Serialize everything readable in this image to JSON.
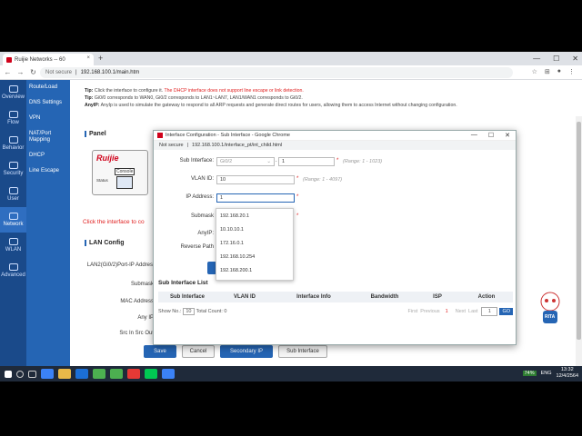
{
  "browser": {
    "tab_title": "Ruijie Networks -- 60",
    "tab_close": "×",
    "new_tab": "+",
    "security": "Not secure",
    "url": "192.168.100.1/main.htm",
    "win_min": "—",
    "win_max": "☐",
    "win_close": "✕"
  },
  "sidebar": {
    "items": [
      {
        "label": "Overview"
      },
      {
        "label": "Flow"
      },
      {
        "label": "Behavior"
      },
      {
        "label": "Security"
      },
      {
        "label": "User"
      },
      {
        "label": "Network"
      },
      {
        "label": "WLAN"
      },
      {
        "label": "Advanced"
      }
    ],
    "sub_items": [
      {
        "label": "Route/Load"
      },
      {
        "label": "DNS Settings"
      },
      {
        "label": "VPN"
      },
      {
        "label": "NAT/Port Mapping"
      },
      {
        "label": "DHCP"
      },
      {
        "label": "Line Escape"
      }
    ]
  },
  "main": {
    "tip1_label": "Tip:",
    "tip1_text": "Click the interface to configure it.",
    "tip1_red": "The DHCP interface does not support line escape or link detection.",
    "tip2_label": "Tip:",
    "tip2_text": "Gi0/0 corresponds to WAN0, Gi0/2 corresponds to LAN1~LAN7, LAN1/WAN1 corresponds to Gi0/2.",
    "tip3_label": "AnyIP:",
    "tip3_text": "AnyIp is used to simulate the gateway to respond to all ARP requests and generate direct routes for users, allowing them to access Internet without changing configuration.",
    "panel_title": "Panel",
    "device_logo": "Ruijie",
    "device_console": "Console",
    "device_status": "Status",
    "click_note": "Click the interface to co",
    "lan_title": "LAN Config",
    "form_labels": [
      "LAN2(Gi0/2)Port-IP Address",
      "Submask",
      "MAC Address",
      "Any IP",
      "Src In Src Out"
    ],
    "buttons": {
      "save": "Save",
      "cancel": "Cancel",
      "secondary_ip": "Secondary IP",
      "sub_interface": "Sub Interface"
    }
  },
  "popup": {
    "title": "Interface Configuration - Sub Interface - Google Chrome",
    "security": "Not secure",
    "url": "192.168.100.1/interface_pt/int_child.html",
    "sub_interface_label": "Sub Interface:",
    "sub_interface_value": "Gi0/2",
    "sub_interface_num": "1",
    "sub_interface_range": "(Range: 1 - 1023)",
    "vlan_label": "VLAN ID:",
    "vlan_value": "10",
    "vlan_range": "(Range: 1 - 4097)",
    "ip_label": "IP Address:",
    "ip_value": "1",
    "submask_label": "Submask",
    "anyip_label": "AnyIP:",
    "reverse_label": "Reverse Path",
    "required": "*",
    "dropdown": [
      "192.168.20.1",
      "10.10.10.1",
      "172.16.0.1",
      "192.168.10.254",
      "192.168.200.1"
    ],
    "list_title": "Sub Interface List",
    "columns": [
      "Sub Interface",
      "VLAN ID",
      "Interface Info",
      "Bandwidth",
      "ISP",
      "Action"
    ],
    "pager": {
      "show_label": "Show No.:",
      "show_value": "10",
      "total": "Total Count: 0",
      "first": "First",
      "prev": "Previous",
      "current": "1",
      "next": "Next",
      "last": "Last",
      "page_value": "1",
      "go": "GO"
    }
  },
  "mascot_label": "RITA",
  "taskbar": {
    "battery": "74%",
    "lang": "ENG",
    "time": "13:32",
    "date": "12/4/2564"
  }
}
